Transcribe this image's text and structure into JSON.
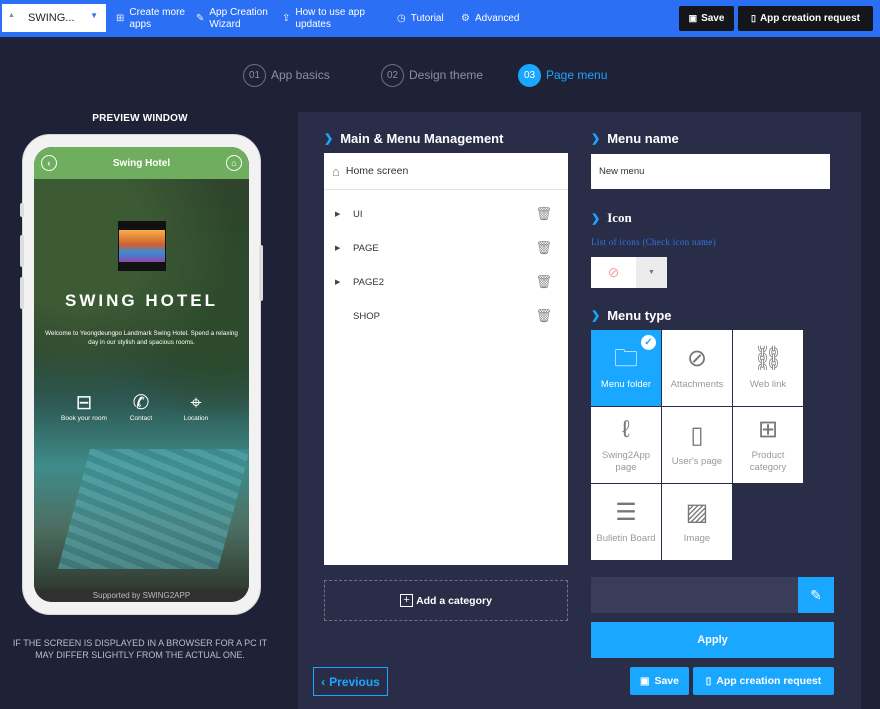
{
  "topbar": {
    "app_select": "SWING...",
    "create_more_apps": "Create more apps",
    "creation_wizard": "App Creation Wizard",
    "how_to_update": "How to use app updates",
    "tutorial": "Tutorial",
    "advanced": "Advanced",
    "save": "Save",
    "creation_request": "App creation request"
  },
  "steps": [
    {
      "num": "01",
      "label": "App basics"
    },
    {
      "num": "02",
      "label": "Design theme"
    },
    {
      "num": "03",
      "label": "Page menu"
    }
  ],
  "preview": {
    "title": "PREVIEW WINDOW",
    "header": "Swing Hotel",
    "hotel_name": "SWING HOTEL",
    "welcome": "Welcome to Yeongdeungpo Landmark Swing Hotel. Spend a relaxing day in our stylish and spacious rooms.",
    "items": [
      "Book your room",
      "Contact",
      "Location"
    ],
    "footer": "Supported by SWING2APP",
    "note": "IF THE SCREEN IS DISPLAYED IN A BROWSER FOR A PC IT MAY DIFFER SLIGHTLY FROM THE ACTUAL ONE."
  },
  "menu_mgmt": {
    "title": "Main & Menu Management",
    "home": "Home screen",
    "items": [
      {
        "label": "UI",
        "expandable": true
      },
      {
        "label": "PAGE",
        "expandable": true
      },
      {
        "label": "PAGE2",
        "expandable": true
      },
      {
        "label": "SHOP",
        "expandable": false
      }
    ],
    "add_category": "Add a category"
  },
  "menu_name": {
    "title": "Menu name",
    "value": "New menu"
  },
  "icon": {
    "title": "Icon",
    "hint": "List of icons (Check icon name)",
    "current": "no-icon"
  },
  "menu_type": {
    "title": "Menu type",
    "types": [
      {
        "label": "Menu folder",
        "icon": "folder-icon",
        "selected": true
      },
      {
        "label": "Attachments",
        "icon": "paperclip-icon",
        "selected": false
      },
      {
        "label": "Web link",
        "icon": "link-icon",
        "selected": false
      },
      {
        "label": "Swing2App page",
        "icon": "signature-icon",
        "selected": false
      },
      {
        "label": "User's page",
        "icon": "page-icon",
        "selected": false
      },
      {
        "label": "Product category",
        "icon": "grid-icon",
        "selected": false
      },
      {
        "label": "Bulletin Board",
        "icon": "board-icon",
        "selected": false
      },
      {
        "label": "Image",
        "icon": "image-icon",
        "selected": false
      }
    ]
  },
  "buttons": {
    "apply": "Apply",
    "previous": "Previous",
    "save": "Save",
    "creation_request": "App creation request"
  },
  "colors": {
    "topbar": "#2b6ff5",
    "accent": "#1aa7ff",
    "background": "#1f2236",
    "panel": "#2a2d47"
  }
}
